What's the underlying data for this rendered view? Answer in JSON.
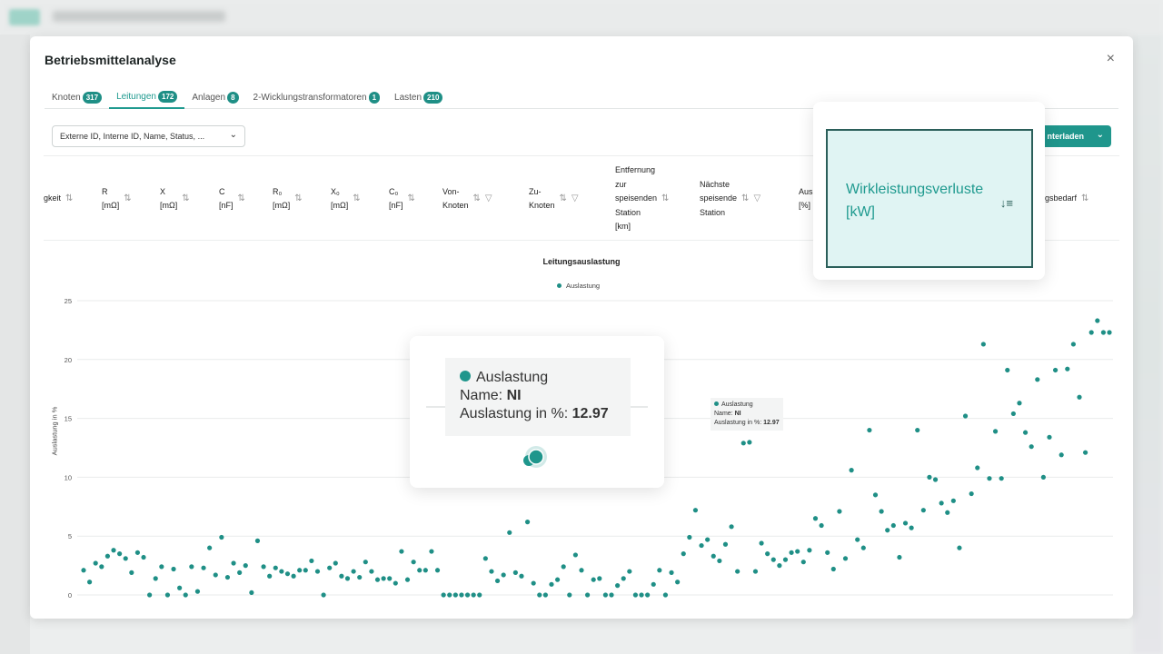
{
  "dialog": {
    "title": "Betriebsmittelanalyse",
    "close_icon": "×"
  },
  "tabs": [
    {
      "label": "Knoten",
      "count": "317"
    },
    {
      "label": "Leitungen",
      "count": "172",
      "active": true
    },
    {
      "label": "Anlagen",
      "count": "8"
    },
    {
      "label": "2-Wicklungstransformatoren",
      "count": "1"
    },
    {
      "label": "Lasten",
      "count": "210"
    }
  ],
  "column_select": {
    "value": "Externe ID, Interne ID, Name, Status, ..."
  },
  "download_button": {
    "label": "nterladen"
  },
  "columns": [
    {
      "lines": [
        "gkeit"
      ],
      "sort": true
    },
    {
      "lines": [
        "R",
        "[mΩ]"
      ],
      "sort": true
    },
    {
      "lines": [
        "X",
        "[mΩ]"
      ],
      "sort": true
    },
    {
      "lines": [
        "C",
        "[nF]"
      ],
      "sort": true
    },
    {
      "lines": [
        "R₀",
        "[mΩ]"
      ],
      "sort": true
    },
    {
      "lines": [
        "X₀",
        "[mΩ]"
      ],
      "sort": true
    },
    {
      "lines": [
        "C₀",
        "[nF]"
      ],
      "sort": true
    },
    {
      "lines": [
        "Von-",
        "Knoten"
      ],
      "sort": true,
      "filter": true
    },
    {
      "lines": [
        "Zu-",
        "Knoten"
      ],
      "sort": true,
      "filter": true
    },
    {
      "lines": [
        "Entfernung",
        "zur",
        "speisenden",
        "Station",
        "[km]"
      ],
      "sort": true
    },
    {
      "lines": [
        "Nächste",
        "speisende",
        "Station"
      ],
      "sort": true,
      "filter": true
    },
    {
      "lines": [
        "Aus",
        "[%]"
      ]
    },
    {
      "lines": [
        "ungsbedarf"
      ],
      "sort": true
    }
  ],
  "highlight": {
    "label_line1": "Wirkleistungsverluste",
    "label_line2": "[kW]",
    "sort_icon": "sort-descending-icon"
  },
  "tooltip": {
    "series": "Auslastung",
    "name_label": "Name: ",
    "name_value": "NI",
    "value_label": "Auslastung in %: ",
    "value": "12.97"
  },
  "chart_data": {
    "type": "scatter",
    "title": "Leitungsauslastung",
    "ylabel": "Auslastung in %",
    "xlabel": "",
    "ylim": [
      0,
      25
    ],
    "yticks": [
      0,
      5,
      10,
      15,
      20,
      25
    ],
    "grid": true,
    "legend": "top-center",
    "series": [
      {
        "name": "Auslastung",
        "color": "#1f8f86",
        "values": [
          2.1,
          1.1,
          2.7,
          2.4,
          3.3,
          3.8,
          3.5,
          3.1,
          1.9,
          3.6,
          3.2,
          0,
          1.4,
          2.4,
          0,
          2.2,
          0.6,
          0,
          2.4,
          0.3,
          2.3,
          4.0,
          1.7,
          4.9,
          1.5,
          2.7,
          1.9,
          2.5,
          0.2,
          4.6,
          2.4,
          1.6,
          2.3,
          2.0,
          1.8,
          1.6,
          2.1,
          2.1,
          2.9,
          2.0,
          0,
          2.3,
          2.7,
          1.6,
          1.4,
          2.0,
          1.5,
          2.8,
          2.0,
          1.3,
          1.4,
          1.4,
          1.0,
          3.7,
          1.3,
          2.8,
          2.1,
          2.1,
          3.7,
          2.1,
          0,
          0,
          0,
          0,
          0,
          0,
          0,
          3.1,
          2.0,
          1.2,
          1.7,
          5.3,
          1.9,
          1.6,
          6.2,
          1.0,
          0,
          0,
          0.9,
          1.3,
          2.4,
          0,
          3.4,
          2.1,
          0,
          1.3,
          1.4,
          0,
          0,
          0.8,
          1.4,
          2.0,
          0,
          0,
          0,
          0.9,
          2.1,
          0,
          1.9,
          1.1,
          3.5,
          4.9,
          7.2,
          4.2,
          4.7,
          3.3,
          2.9,
          4.3,
          5.8,
          2.0,
          12.9,
          12.97,
          2.0,
          4.4,
          3.5,
          3.0,
          2.5,
          3.0,
          3.6,
          3.7,
          2.8,
          3.8,
          6.5,
          5.9,
          3.6,
          2.2,
          7.1,
          3.1,
          10.6,
          4.7,
          4.0,
          14.0,
          8.5,
          7.1,
          5.5,
          5.9,
          3.2,
          6.1,
          5.7,
          14.0,
          7.2,
          10.0,
          9.8,
          7.8,
          7.0,
          8.0,
          4.0,
          15.2,
          8.6,
          10.8,
          21.3,
          9.9,
          13.9,
          9.9,
          19.1,
          15.4,
          16.3,
          13.8,
          12.6,
          18.3,
          10.0,
          13.4,
          19.1,
          11.9,
          19.2,
          21.3,
          16.8,
          12.1,
          22.3,
          23.3,
          22.3,
          22.3
        ]
      }
    ]
  }
}
